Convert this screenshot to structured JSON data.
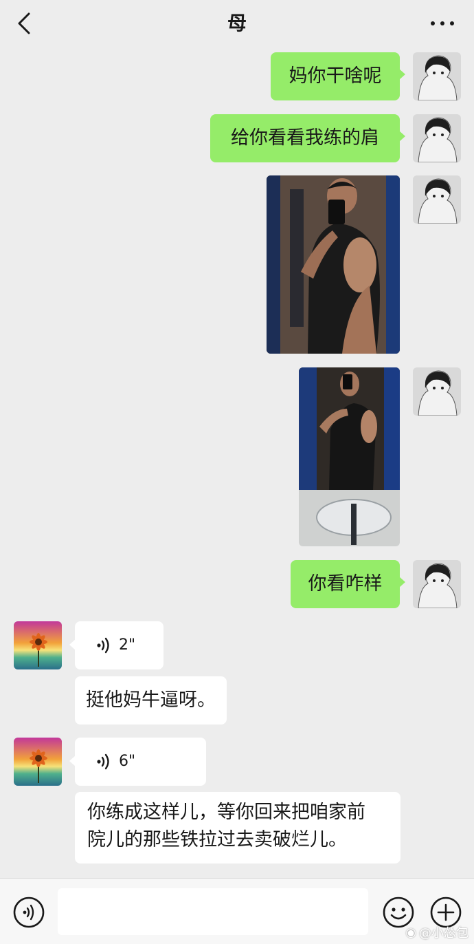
{
  "header": {
    "title": "母",
    "back_icon": "chevron-left-icon",
    "more_icon": "more-dots-icon"
  },
  "messages": [
    {
      "id": "m1",
      "side": "out",
      "type": "text",
      "text": "妈你干啥呢"
    },
    {
      "id": "m2",
      "side": "out",
      "type": "text",
      "text": "给你看看我练的肩"
    },
    {
      "id": "m3",
      "side": "out",
      "type": "image",
      "description": "mirror selfie"
    },
    {
      "id": "m4",
      "side": "out",
      "type": "image",
      "description": "mirror selfie with sink"
    },
    {
      "id": "m5",
      "side": "out",
      "type": "text",
      "text": "你看咋样"
    },
    {
      "id": "m6",
      "side": "in",
      "type": "voice",
      "duration": "2\""
    },
    {
      "id": "m7",
      "side": "in",
      "type": "text",
      "text": "挺他妈牛逼呀。"
    },
    {
      "id": "m8",
      "side": "in",
      "type": "voice",
      "duration": "6\""
    },
    {
      "id": "m9",
      "side": "in",
      "type": "text",
      "lines": [
        "你练成这样儿，等你回来把咱家前",
        "院儿的那些铁拉过去卖破烂儿。"
      ]
    }
  ],
  "input_bar": {
    "voice_icon": "voice-mode-icon",
    "emoji_icon": "emoji-icon",
    "plus_icon": "plus-icon",
    "input_value": ""
  },
  "watermark": {
    "text": "@小怂包"
  },
  "colors": {
    "background": "#ededed",
    "out_bubble": "#95ec69",
    "in_bubble": "#ffffff"
  }
}
